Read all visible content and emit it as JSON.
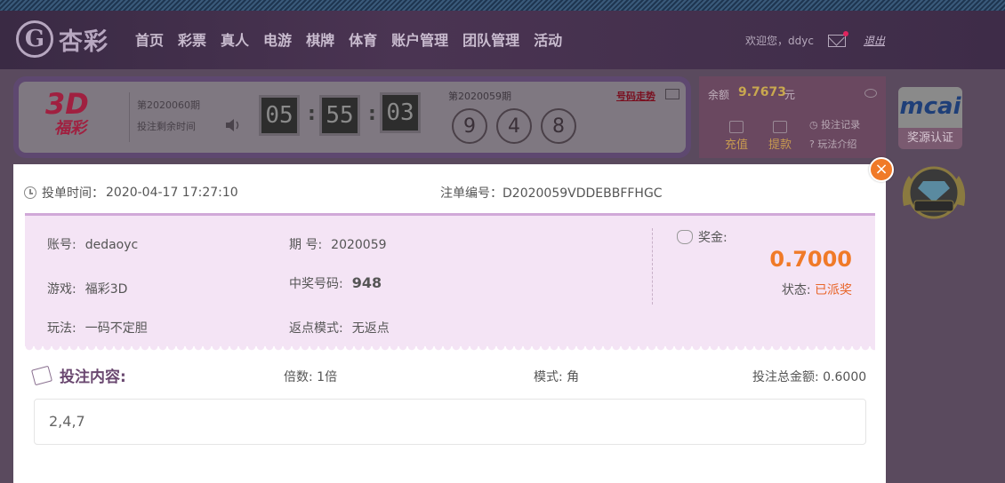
{
  "header": {
    "logo_mark": "G",
    "logo_text": "杏彩",
    "nav": [
      "首页",
      "彩票",
      "真人",
      "电游",
      "棋牌",
      "体育",
      "账户管理",
      "团队管理",
      "活动"
    ],
    "welcome": "欢迎您，ddyc",
    "logout": "退出"
  },
  "game": {
    "logo_big": "3D",
    "logo_small": "福彩",
    "current_period": "第2020060期",
    "remain_label": "投注剩余时间",
    "timer": [
      "05",
      "55",
      "03"
    ],
    "last_period": "第2020059期",
    "last_numbers": [
      "9",
      "4",
      "8"
    ],
    "trend_label": "号码走势"
  },
  "balance": {
    "label": "余额",
    "value": "9.7673",
    "unit": "元",
    "recharge": "充值",
    "withdraw": "提款",
    "bet_record": "投注记录",
    "play_intro": "玩法介绍"
  },
  "side": {
    "mcai_logo": "mcai",
    "mcai_cert": "奖源认证"
  },
  "modal": {
    "close_glyph": "×",
    "bet_time_label": "投单时间：",
    "bet_time": "2020-04-17 17:27:10",
    "order_no_label": "注单编号：",
    "order_no": "D2020059VDDEBBFFHGC",
    "account_label": "账号:",
    "account": "dedaoyc",
    "period_label": "期 号:",
    "period": "2020059",
    "game_label": "游戏:",
    "game": "福彩3D",
    "win_number_label": "中奖号码:",
    "win_number": "948",
    "play_label": "玩法:",
    "play": "一码不定胆",
    "rebate_label": "返点模式:",
    "rebate": "无返点",
    "prize_label": "奖金:",
    "prize": "0.7000",
    "status_label": "状态:",
    "status": "已派奖",
    "content_label": "投注内容:",
    "multiple_label": "倍数:",
    "multiple": "1倍",
    "mode_label": "模式:",
    "mode": "角",
    "total_label": "投注总金额:",
    "total": "0.6000",
    "bet_content": "2,4,7"
  }
}
